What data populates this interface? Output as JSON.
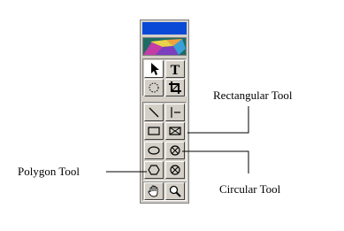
{
  "toolbox": {
    "title_color": "#0a49d6",
    "tools": [
      {
        "name": "pointer-tool",
        "icon": "arrow-cursor-icon"
      },
      {
        "name": "text-tool",
        "icon": "text-T-icon"
      },
      {
        "name": "lasso-tool",
        "icon": "lasso-icon"
      },
      {
        "name": "crop-tool",
        "icon": "crop-icon"
      },
      {
        "name": "line-tool",
        "icon": "diagonal-line-icon"
      },
      {
        "name": "perpendicular-line-tool",
        "icon": "perpendicular-line-icon"
      },
      {
        "name": "rectangular-tool",
        "icon": "rectangle-icon"
      },
      {
        "name": "rectangular-crossed-tool",
        "icon": "crossed-rectangle-icon"
      },
      {
        "name": "ellipse-tool",
        "icon": "ellipse-icon"
      },
      {
        "name": "circular-crossed-tool",
        "icon": "crossed-circle-icon"
      },
      {
        "name": "polygon-tool",
        "icon": "hexagon-icon"
      },
      {
        "name": "polygon-crossed-tool",
        "icon": "crossed-circle-icon"
      },
      {
        "name": "hand-tool",
        "icon": "hand-icon"
      },
      {
        "name": "zoom-tool",
        "icon": "magnifier-icon"
      }
    ]
  },
  "annotations": {
    "rectangular": "Rectangular Tool",
    "polygon": "Polygon Tool",
    "circular": "Circular Tool"
  }
}
